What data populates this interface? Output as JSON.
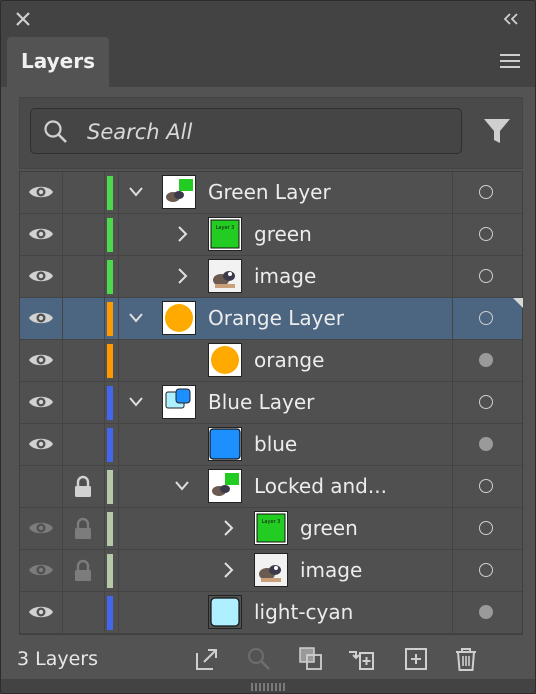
{
  "panel": {
    "tab_label": "Layers",
    "search_placeholder": "Search All",
    "footer_count": "3 Layers"
  },
  "colors": {
    "panel_bg": "#535353",
    "selected_row": "#4c6580",
    "green_layer": "#4cd94c",
    "orange_layer": "#ff9900",
    "blue_layer": "#4466ee",
    "locked_layer": "#b5c9a8"
  },
  "rows": [
    {
      "label": "Green Layer",
      "visible": true,
      "locked": false,
      "expander": "open",
      "color": "#4cd94c",
      "thumb": "green-layer-thumb",
      "target": "hollow"
    },
    {
      "label": "green",
      "visible": true,
      "locked": false,
      "expander": "closed",
      "color": "#4cd94c",
      "thumb": "green-square-thumb",
      "target": "hollow"
    },
    {
      "label": "image",
      "visible": true,
      "locked": false,
      "expander": "closed",
      "color": "#4cd94c",
      "thumb": "image-thumb",
      "target": "hollow"
    },
    {
      "label": "Orange Layer",
      "visible": true,
      "locked": false,
      "expander": "open",
      "color": "#ff9900",
      "thumb": "orange-layer-thumb",
      "target": "hollow",
      "selected": true
    },
    {
      "label": "orange",
      "visible": true,
      "locked": false,
      "expander": "none",
      "color": "#ff9900",
      "thumb": "orange-circle-thumb",
      "target": "filled"
    },
    {
      "label": "Blue Layer",
      "visible": true,
      "locked": false,
      "expander": "open",
      "color": "#4466ee",
      "thumb": "blue-layer-thumb",
      "target": "hollow"
    },
    {
      "label": "blue",
      "visible": true,
      "locked": false,
      "expander": "none",
      "color": "#4466ee",
      "thumb": "blue-square-thumb",
      "target": "filled"
    },
    {
      "label": "Locked and...",
      "visible": false,
      "locked": true,
      "expander": "open",
      "color": "#b5c9a8",
      "thumb": "locked-group-thumb",
      "target": "hollow"
    },
    {
      "label": "green",
      "visible": "dim",
      "locked": "dim",
      "expander": "closed",
      "color": "#b5c9a8",
      "thumb": "green-square-thumb",
      "target": "hollow"
    },
    {
      "label": "image",
      "visible": "dim",
      "locked": "dim",
      "expander": "closed",
      "color": "#b5c9a8",
      "thumb": "image-thumb",
      "target": "hollow"
    },
    {
      "label": "light-cyan",
      "visible": true,
      "locked": false,
      "expander": "none",
      "color": "#4466ee",
      "thumb": "light-cyan-thumb",
      "target": "filled"
    }
  ],
  "thumb_text": "Layer 3"
}
